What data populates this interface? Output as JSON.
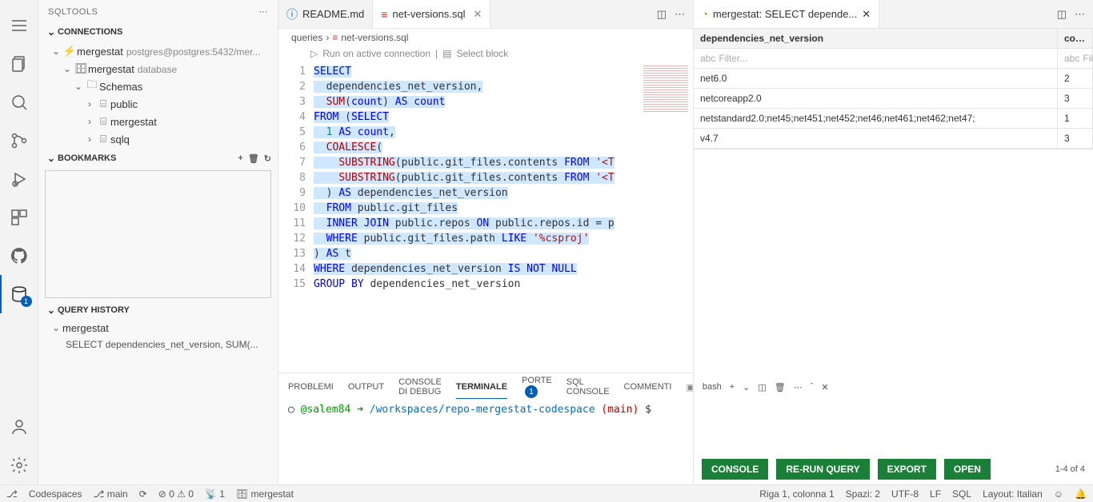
{
  "sidebar": {
    "title": "SQLTOOLS",
    "sections": {
      "connections": {
        "title": "CONNECTIONS",
        "items": [
          {
            "label": "mergestat",
            "suffix": "postgres@postgres:5432/mer..."
          },
          {
            "label": "mergestat",
            "suffix": "database"
          },
          {
            "label": "Schemas"
          },
          {
            "label": "public"
          },
          {
            "label": "mergestat"
          },
          {
            "label": "sqlq"
          }
        ]
      },
      "bookmarks": {
        "title": "BOOKMARKS"
      },
      "queryHistory": {
        "title": "QUERY HISTORY",
        "group": "mergestat",
        "item": "SELECT dependencies_net_version, SUM(..."
      }
    }
  },
  "tabs": [
    {
      "icon": "ⓘ",
      "label": "README.md"
    },
    {
      "icon": "≡",
      "label": "net-versions.sql",
      "active": true
    }
  ],
  "breadcrumb": {
    "parts": [
      "queries",
      "net-versions.sql"
    ]
  },
  "runRow": {
    "run": "Run on active connection",
    "select": "Select block"
  },
  "code": {
    "lines": [
      "SELECT",
      "  dependencies_net_version,",
      "  SUM(count) AS count",
      "FROM (SELECT",
      "  1 AS count,",
      "  COALESCE(",
      "    SUBSTRING(public.git_files.contents FROM '<T",
      "    SUBSTRING(public.git_files.contents FROM '<T",
      "  ) AS dependencies_net_version",
      "  FROM public.git_files",
      "  INNER JOIN public.repos ON public.repos.id = p",
      "  WHERE public.git_files.path LIKE '%csproj'",
      ") AS t",
      "WHERE dependencies_net_version IS NOT NULL",
      "GROUP BY dependencies_net_version"
    ]
  },
  "panel": {
    "tabs": {
      "problemi": "PROBLEMI",
      "output": "OUTPUT",
      "debug": "CONSOLE DI DEBUG",
      "terminal": "TERMINALE",
      "porte": "PORTE",
      "porteBadge": "1",
      "sql": "SQL CONSOLE",
      "commenti": "COMMENTI"
    },
    "term": {
      "circle": "○",
      "user": "@salem84",
      "arrow": "➜",
      "path": "/workspaces/repo-mergestat-codespace",
      "branch": "(main)",
      "prompt": "$"
    },
    "shell": "bash"
  },
  "results": {
    "tabLabel": "mergestat: SELECT depende...",
    "headers": {
      "c1": "dependencies_net_version",
      "c2": "count"
    },
    "filterPlaceholder": "Filter...",
    "filterShort": "Filt",
    "rows": [
      {
        "c1": "net6.0",
        "c2": "2"
      },
      {
        "c1": "netcoreapp2.0",
        "c2": "3"
      },
      {
        "c1": "netstandard2.0;net45;net451;net452;net46;net461;net462;net47;",
        "c2": "1"
      },
      {
        "c1": "v4.7",
        "c2": "3"
      }
    ],
    "buttons": {
      "console": "CONSOLE",
      "rerun": "RE-RUN QUERY",
      "export": "EXPORT",
      "open": "OPEN"
    },
    "count": "1-4 of 4"
  },
  "status": {
    "codespaces": "Codespaces",
    "branch": "main",
    "errors": "0",
    "warnings": "0",
    "radio": "1",
    "db": "mergestat",
    "pos": "Riga 1, colonna 1",
    "spaces": "Spazi: 2",
    "enc": "UTF-8",
    "eol": "LF",
    "lang": "SQL",
    "layout": "Layout: Italian"
  }
}
